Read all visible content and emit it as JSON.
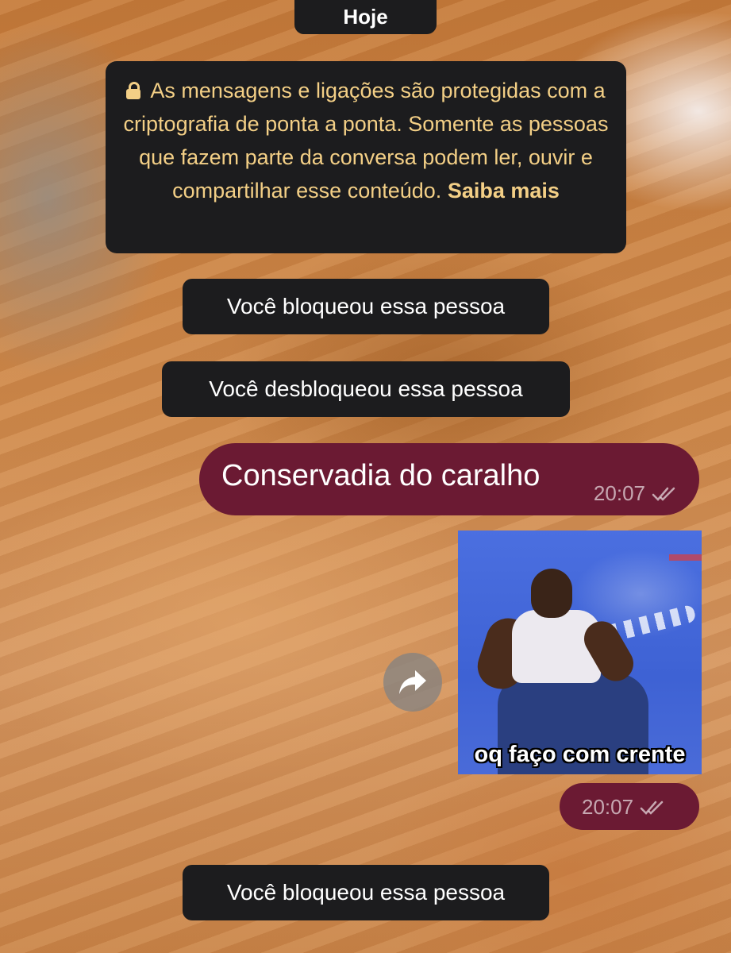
{
  "chat": {
    "date_label": "Hoje",
    "encryption_notice": {
      "icon": "lock-icon",
      "text": "As mensagens e ligações são protegidas com a criptografia de ponta a ponta. Somente as pessoas que fazem parte da conversa podem ler, ouvir e compartilhar esse conteúdo.",
      "link": "Saiba mais",
      "color": "#f3cf86"
    },
    "events": [
      "Você bloqueou essa pessoa",
      "Você desbloqueou essa pessoa",
      "Você bloqueou essa pessoa"
    ],
    "messages": [
      {
        "type": "text",
        "text": "Conservadia do caralho",
        "time": "20:07",
        "status": "read",
        "status_icon": "double-check-icon"
      },
      {
        "type": "sticker",
        "caption": "oq faço com crente",
        "time": "20:07",
        "status": "read",
        "status_icon": "double-check-icon",
        "forward_icon": "forward-arrow-icon"
      }
    ]
  },
  "colors": {
    "outgoing_bubble": "#6b1a33",
    "system_bubble": "#1c1c1e",
    "notice_text": "#f3cf86"
  }
}
